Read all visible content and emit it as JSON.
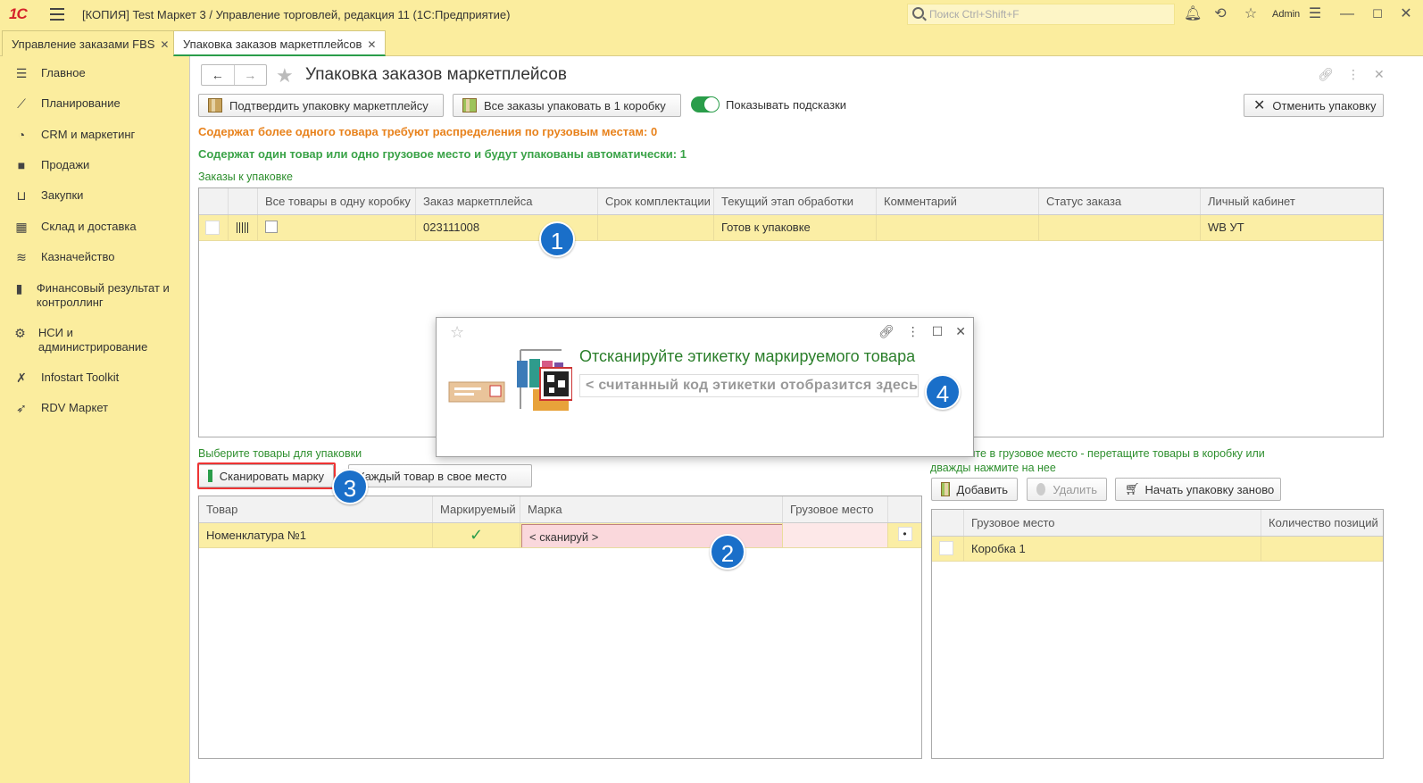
{
  "app": {
    "title": "[КОПИЯ] Test Маркет 3 / Управление торговлей, редакция 11  (1С:Предприятие)",
    "logo": "1С",
    "search_placeholder": "Поиск Ctrl+Shift+F",
    "user": "Admin"
  },
  "tabs": [
    {
      "label": "Управление заказами FBS",
      "close": "✕"
    },
    {
      "label": "Упаковка заказов маркетплейсов",
      "close": "✕"
    }
  ],
  "sidebar": {
    "items": [
      {
        "label": "Главное",
        "icon": "menu-lines-icon"
      },
      {
        "label": "Планирование",
        "icon": "chart-up-icon"
      },
      {
        "label": "CRM и маркетинг",
        "icon": "pie-icon"
      },
      {
        "label": "Продажи",
        "icon": "bag-icon"
      },
      {
        "label": "Закупки",
        "icon": "cart-icon"
      },
      {
        "label": "Склад и доставка",
        "icon": "warehouse-icon"
      },
      {
        "label": "Казначейство",
        "icon": "coins-icon"
      },
      {
        "label": "Финансовый результат и контроллинг",
        "icon": "bars-icon"
      },
      {
        "label": "НСИ и администрирование",
        "icon": "gear-icon"
      },
      {
        "label": "Infostart Toolkit",
        "icon": "tools-icon"
      },
      {
        "label": "RDV Маркет",
        "icon": "rocket-icon"
      }
    ]
  },
  "page": {
    "title": "Упаковка заказов маркетплейсов",
    "nav_back": "←",
    "nav_forward": "→",
    "buttons": {
      "confirm": "Подтвердить упаковку маркетплейсу",
      "pack_all": "Все заказы упаковать в 1 коробку",
      "show_hints": "Показывать подсказки",
      "cancel": "Отменить упаковку"
    },
    "info_orange": "Содержат более одного товара требуют распределения по грузовым местам: 0",
    "info_green": "Содержат один товар или одно грузовое место и будут упакованы автоматически: 1",
    "orders_label": "Заказы к упаковке"
  },
  "orders_table": {
    "columns": [
      "",
      "",
      "Все товары в одну коробку",
      "Заказ маркетплейса",
      "Срок комплектации",
      "Текущий этап обработки",
      "Комментарий",
      "Статус заказа",
      "Личный кабинет"
    ],
    "rows": [
      {
        "order": "023111008",
        "deadline": "",
        "stage": "Готов к упаковке",
        "comment": "",
        "status": "",
        "cabinet": "WB УТ"
      }
    ]
  },
  "goods": {
    "label": "Выберите товары для упаковки",
    "scan_button": "Сканировать марку",
    "each_button": "Каждый товар в свое место",
    "columns": [
      "Товар",
      "Маркируемый",
      "Марка",
      "Грузовое место",
      ""
    ],
    "rows": [
      {
        "item": "Номенклатура №1",
        "mark_placeholder": "< сканируй >",
        "place": "",
        "dot": "•"
      }
    ]
  },
  "places": {
    "label": "Поместите в грузовое место - перетащите товары в коробку или дважды нажмите на нее",
    "add": "Добавить",
    "delete": "Удалить",
    "restart": "Начать упаковку заново",
    "columns": [
      "",
      "Грузовое место",
      "Количество позиций"
    ],
    "rows": [
      {
        "place": "Коробка 1",
        "count": ""
      }
    ]
  },
  "dialog": {
    "title": "Отсканируйте этикетку маркируемого товара",
    "placeholder": "< считанный код этикетки отобразится здесь >"
  },
  "badges": [
    "1",
    "2",
    "3",
    "4"
  ],
  "colors": {
    "accent_green": "#2a9d4a",
    "orange": "#e8821c",
    "badge_blue": "#1a6fc9",
    "row_highlight": "#fbeea5",
    "background_yellow": "#fbed9e"
  }
}
